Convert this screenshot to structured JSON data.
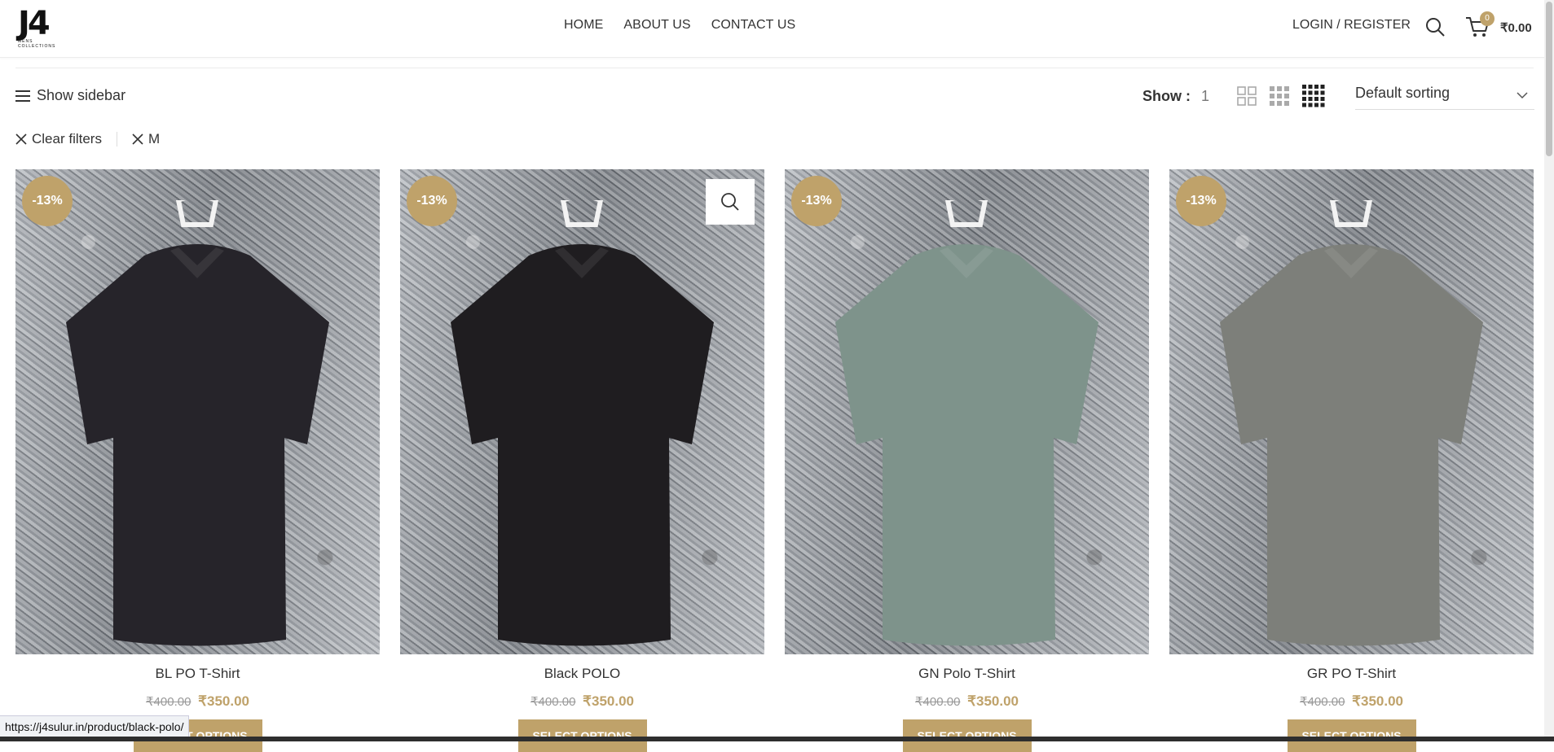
{
  "header": {
    "logo_text": "J4",
    "logo_sub": "MENS COLLECTIONS",
    "nav": [
      "HOME",
      "ABOUT US",
      "CONTACT US"
    ],
    "login_label": "LOGIN / REGISTER",
    "cart_count": "0",
    "cart_total": "₹0.00"
  },
  "toolbar": {
    "show_sidebar_label": "Show sidebar",
    "per_page_label": "Show :",
    "per_page_value": "1",
    "sort_label": "Default sorting"
  },
  "filters": {
    "clear_label": "Clear filters",
    "active": [
      {
        "label": "M"
      }
    ]
  },
  "products": [
    {
      "name": "BL PO T-Shirt",
      "badge": "-13%",
      "old_price": "₹400.00",
      "price": "₹350.00",
      "button": "Select options",
      "shirt_color": "#26242a"
    },
    {
      "name": "Black POLO",
      "badge": "-13%",
      "old_price": "₹400.00",
      "price": "₹350.00",
      "button": "Select options",
      "shirt_color": "#1f1d20"
    },
    {
      "name": "GN Polo T-Shirt",
      "badge": "-13%",
      "old_price": "₹400.00",
      "price": "₹350.00",
      "button": "Select options",
      "shirt_color": "#7e938b"
    },
    {
      "name": "GR PO T-Shirt",
      "badge": "-13%",
      "old_price": "₹400.00",
      "price": "₹350.00",
      "button": "Select options",
      "shirt_color": "#7d7f7a"
    }
  ],
  "status_url": "https://j4sulur.in/product/black-polo/",
  "colors": {
    "accent": "#bfa26a"
  }
}
